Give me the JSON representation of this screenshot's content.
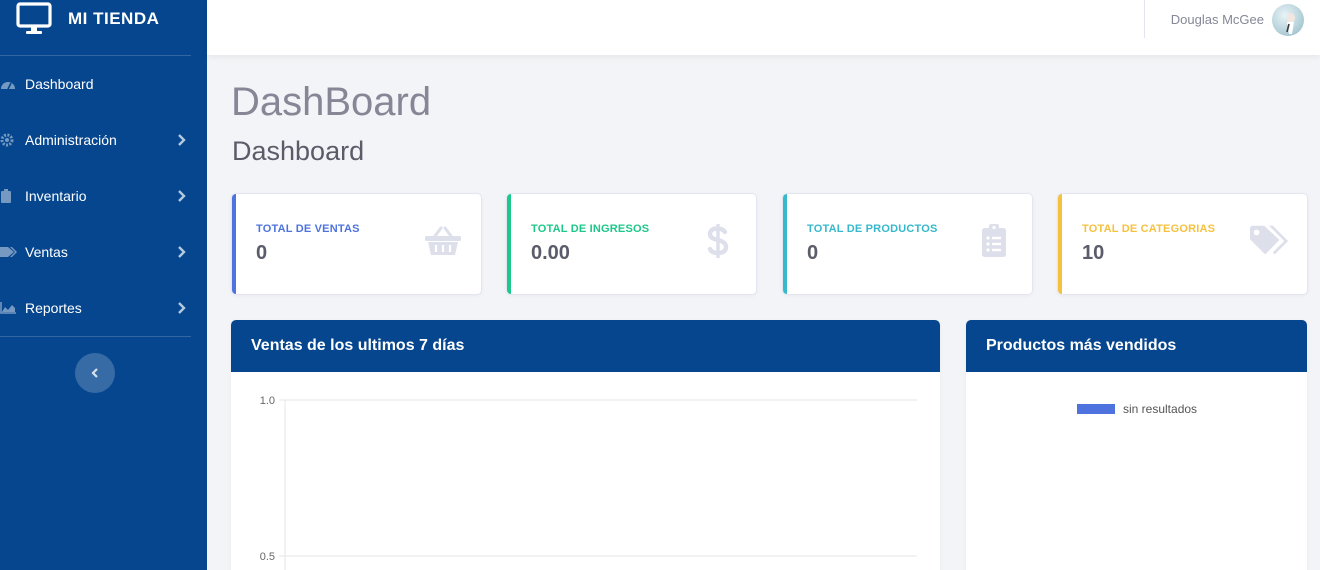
{
  "app": {
    "brand": "MI TIENDA"
  },
  "sidebar": {
    "items": [
      {
        "label": "Dashboard",
        "icon": "tachometer-icon",
        "has_submenu": false
      },
      {
        "label": "Administración",
        "icon": "gear-icon",
        "has_submenu": true
      },
      {
        "label": "Inventario",
        "icon": "clipboard-icon",
        "has_submenu": true
      },
      {
        "label": "Ventas",
        "icon": "tags-icon",
        "has_submenu": true
      },
      {
        "label": "Reportes",
        "icon": "area-chart-icon",
        "has_submenu": true
      }
    ]
  },
  "topbar": {
    "user_name": "Douglas McGee"
  },
  "page": {
    "title": "DashBoard",
    "subtitle": "Dashboard"
  },
  "cards": [
    {
      "label": "TOTAL DE VENTAS",
      "value": "0",
      "color": "#4e73df",
      "icon": "basket-icon"
    },
    {
      "label": "TOTAL DE INGRESOS",
      "value": "0.00",
      "color": "#1cc88a",
      "icon": "dollar-icon"
    },
    {
      "label": "TOTAL DE PRODUCTOS",
      "value": "0",
      "color": "#36b9cc",
      "icon": "clipboard-list-icon"
    },
    {
      "label": "TOTAL DE CATEGORIAS",
      "value": "10",
      "color": "#f6c23e",
      "icon": "tags-icon"
    }
  ],
  "panels": {
    "sales": {
      "title": "Ventas de los ultimos 7 días"
    },
    "top_products": {
      "title": "Productos más vendidos",
      "legend_label": "sin resultados"
    }
  },
  "colors": {
    "sidebar": "#05468f",
    "primary": "#4e73df"
  },
  "chart_data": {
    "type": "line",
    "title": "",
    "xlabel": "",
    "ylabel": "",
    "x": [],
    "series": [],
    "y_ticks": [
      "1.0",
      "0.5"
    ],
    "ylim": [
      0,
      1.0
    ],
    "grid": true
  }
}
